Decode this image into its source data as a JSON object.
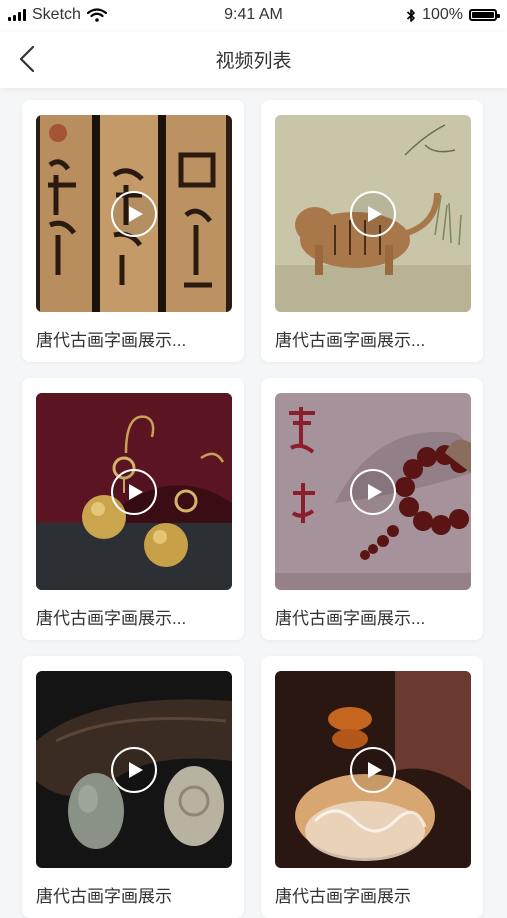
{
  "status_bar": {
    "carrier": "Sketch",
    "time": "9:41 AM",
    "battery": "100%",
    "icons": [
      "signal-icon",
      "wifi-icon",
      "bluetooth-icon",
      "battery-icon"
    ]
  },
  "navbar": {
    "title": "视频列表",
    "back_icon": "chevron-left-icon"
  },
  "videos": [
    {
      "caption": "唐代古画字画展示...",
      "thumbnail": "calligraphy-scrolls"
    },
    {
      "caption": "唐代古画字画展示...",
      "thumbnail": "tiger-painting"
    },
    {
      "caption": "唐代古画字画展示...",
      "thumbnail": "pearl-earrings"
    },
    {
      "caption": "唐代古画字画展示...",
      "thumbnail": "red-bead-bracelet"
    },
    {
      "caption": "唐代古画字画展示",
      "thumbnail": "jade-pendant"
    },
    {
      "caption": "唐代古画字画展示",
      "thumbnail": "amber-carving"
    }
  ],
  "colors": {
    "background": "#f5f6f7",
    "card": "#ffffff",
    "text": "#333333"
  }
}
